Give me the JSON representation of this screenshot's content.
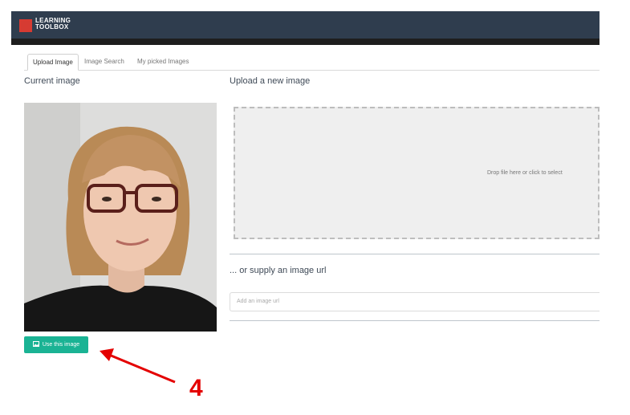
{
  "app": {
    "logo_text_line1": "LEARNING",
    "logo_text_line2": "TOOLBOX"
  },
  "tabs": [
    {
      "label": "Upload Image",
      "active": true
    },
    {
      "label": "Image Search",
      "active": false
    },
    {
      "label": "My picked Images",
      "active": false
    }
  ],
  "left": {
    "title": "Current image",
    "use_button_label": "Use this image",
    "use_button_icon": "image-icon"
  },
  "right": {
    "title": "Upload a new image",
    "dropzone_text": "Drop file here or click to select",
    "url_title": "... or supply an image url",
    "url_placeholder": "Add an image url"
  },
  "annotation": {
    "number": "4",
    "color": "#e40000"
  },
  "colors": {
    "header": "#2f3d4e",
    "accent": "#1ab394",
    "logo": "#d63b32"
  }
}
